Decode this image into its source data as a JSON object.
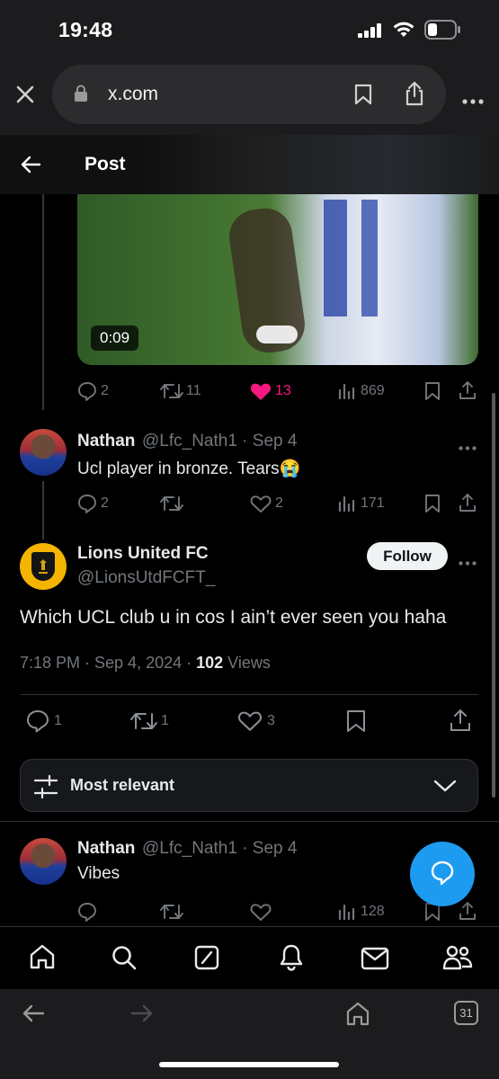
{
  "status_bar": {
    "time": "19:48"
  },
  "browser": {
    "url": "x.com"
  },
  "header": {
    "title": "Post"
  },
  "video": {
    "duration": "0:09"
  },
  "top_post_actions": {
    "replies": "2",
    "reposts": "11",
    "likes": "13",
    "views": "869",
    "liked": true
  },
  "reply1": {
    "name": "Nathan",
    "handle": "@Lfc_Nath1 · Sep 4",
    "text": "Ucl player in bronze. Tears😭",
    "replies": "2",
    "reposts": "",
    "likes": "2",
    "views": "171"
  },
  "main_post": {
    "name": "Lions United FC",
    "handle": "@LionsUtdFCFT_",
    "follow_label": "Follow",
    "text": "Which UCL club u in cos I ain’t ever seen you haha",
    "time": "7:18 PM · Sep 4, 2024 · ",
    "views_count": "102",
    "views_label": " Views",
    "replies": "1",
    "reposts": "1",
    "likes": "3"
  },
  "sort": {
    "label": "Most relevant"
  },
  "reply2": {
    "name": "Nathan",
    "handle": "@Lfc_Nath1 · Sep 4",
    "text": "Vibes",
    "views": "128"
  },
  "browser_nav": {
    "tabs_count": "31"
  },
  "colors": {
    "like_pink": "#f91880",
    "accent_blue": "#1d9bf0",
    "follow_bg": "#eff3f4"
  }
}
